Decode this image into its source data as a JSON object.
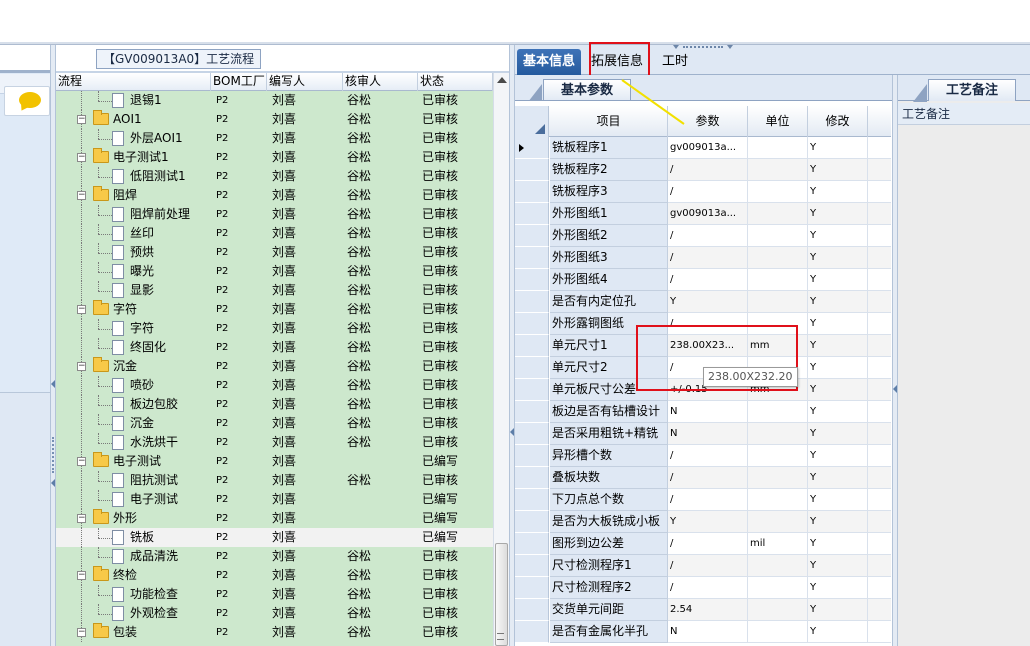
{
  "process_panel": {
    "title": "【GV009013A0】工艺流程",
    "columns": [
      "流程",
      "BOM工厂",
      "编写人",
      "核审人",
      "状态"
    ],
    "rows": [
      {
        "level": 2,
        "kind": "doc",
        "name": "退锡1",
        "bom": "P2",
        "author": "刘喜",
        "reviewer": "谷松",
        "status": "已审核"
      },
      {
        "level": 1,
        "kind": "folder",
        "name": "AOI1",
        "bom": "P2",
        "author": "刘喜",
        "reviewer": "谷松",
        "status": "已审核"
      },
      {
        "level": 2,
        "kind": "doc",
        "name": "外层AOI1",
        "bom": "P2",
        "author": "刘喜",
        "reviewer": "谷松",
        "status": "已审核"
      },
      {
        "level": 1,
        "kind": "folder",
        "name": "电子测试1",
        "bom": "P2",
        "author": "刘喜",
        "reviewer": "谷松",
        "status": "已审核"
      },
      {
        "level": 2,
        "kind": "doc",
        "name": "低阻测试1",
        "bom": "P2",
        "author": "刘喜",
        "reviewer": "谷松",
        "status": "已审核"
      },
      {
        "level": 1,
        "kind": "folder",
        "name": "阻焊",
        "bom": "P2",
        "author": "刘喜",
        "reviewer": "谷松",
        "status": "已审核"
      },
      {
        "level": 2,
        "kind": "doc",
        "name": "阻焊前处理",
        "bom": "P2",
        "author": "刘喜",
        "reviewer": "谷松",
        "status": "已审核"
      },
      {
        "level": 2,
        "kind": "doc",
        "name": "丝印",
        "bom": "P2",
        "author": "刘喜",
        "reviewer": "谷松",
        "status": "已审核"
      },
      {
        "level": 2,
        "kind": "doc",
        "name": "预烘",
        "bom": "P2",
        "author": "刘喜",
        "reviewer": "谷松",
        "status": "已审核"
      },
      {
        "level": 2,
        "kind": "doc",
        "name": "曝光",
        "bom": "P2",
        "author": "刘喜",
        "reviewer": "谷松",
        "status": "已审核"
      },
      {
        "level": 2,
        "kind": "doc",
        "name": "显影",
        "bom": "P2",
        "author": "刘喜",
        "reviewer": "谷松",
        "status": "已审核"
      },
      {
        "level": 1,
        "kind": "folder",
        "name": "字符",
        "bom": "P2",
        "author": "刘喜",
        "reviewer": "谷松",
        "status": "已审核"
      },
      {
        "level": 2,
        "kind": "doc",
        "name": "字符",
        "bom": "P2",
        "author": "刘喜",
        "reviewer": "谷松",
        "status": "已审核"
      },
      {
        "level": 2,
        "kind": "doc",
        "name": "终固化",
        "bom": "P2",
        "author": "刘喜",
        "reviewer": "谷松",
        "status": "已审核"
      },
      {
        "level": 1,
        "kind": "folder",
        "name": "沉金",
        "bom": "P2",
        "author": "刘喜",
        "reviewer": "谷松",
        "status": "已审核"
      },
      {
        "level": 2,
        "kind": "doc",
        "name": "喷砂",
        "bom": "P2",
        "author": "刘喜",
        "reviewer": "谷松",
        "status": "已审核"
      },
      {
        "level": 2,
        "kind": "doc",
        "name": "板边包胶",
        "bom": "P2",
        "author": "刘喜",
        "reviewer": "谷松",
        "status": "已审核"
      },
      {
        "level": 2,
        "kind": "doc",
        "name": "沉金",
        "bom": "P2",
        "author": "刘喜",
        "reviewer": "谷松",
        "status": "已审核"
      },
      {
        "level": 2,
        "kind": "doc",
        "name": "水洗烘干",
        "bom": "P2",
        "author": "刘喜",
        "reviewer": "谷松",
        "status": "已审核"
      },
      {
        "level": 1,
        "kind": "folder",
        "name": "电子测试",
        "bom": "P2",
        "author": "刘喜",
        "reviewer": "",
        "status": "已编写"
      },
      {
        "level": 2,
        "kind": "doc",
        "name": "阻抗测试",
        "bom": "P2",
        "author": "刘喜",
        "reviewer": "谷松",
        "status": "已审核"
      },
      {
        "level": 2,
        "kind": "doc",
        "name": "电子测试",
        "bom": "P2",
        "author": "刘喜",
        "reviewer": "",
        "status": "已编写"
      },
      {
        "level": 1,
        "kind": "folder",
        "name": "外形",
        "bom": "P2",
        "author": "刘喜",
        "reviewer": "",
        "status": "已编写"
      },
      {
        "level": 2,
        "kind": "doc",
        "name": "铣板",
        "bom": "P2",
        "author": "刘喜",
        "reviewer": "",
        "status": "已编写",
        "selected": true
      },
      {
        "level": 2,
        "kind": "doc",
        "name": "成品清洗",
        "bom": "P2",
        "author": "刘喜",
        "reviewer": "谷松",
        "status": "已审核"
      },
      {
        "level": 1,
        "kind": "folder",
        "name": "终检",
        "bom": "P2",
        "author": "刘喜",
        "reviewer": "谷松",
        "status": "已审核"
      },
      {
        "level": 2,
        "kind": "doc",
        "name": "功能检查",
        "bom": "P2",
        "author": "刘喜",
        "reviewer": "谷松",
        "status": "已审核"
      },
      {
        "level": 2,
        "kind": "doc",
        "name": "外观检查",
        "bom": "P2",
        "author": "刘喜",
        "reviewer": "谷松",
        "status": "已审核"
      },
      {
        "level": 1,
        "kind": "folder",
        "name": "包装",
        "bom": "P2",
        "author": "刘喜",
        "reviewer": "谷松",
        "status": "已审核"
      }
    ]
  },
  "tabs": {
    "basic": "基本信息",
    "extended": "拓展信息",
    "hours": "工时"
  },
  "params_panel": {
    "subtab": "基本参数",
    "columns": [
      "项目",
      "参数",
      "单位",
      "修改"
    ],
    "rows": [
      {
        "item": "铣板程序1",
        "value": "gv009013a...",
        "unit": "",
        "modify": "Y"
      },
      {
        "item": "铣板程序2",
        "value": "/",
        "unit": "",
        "modify": "Y"
      },
      {
        "item": "铣板程序3",
        "value": "/",
        "unit": "",
        "modify": "Y"
      },
      {
        "item": "外形图纸1",
        "value": "gv009013a...",
        "unit": "",
        "modify": "Y"
      },
      {
        "item": "外形图纸2",
        "value": "/",
        "unit": "",
        "modify": "Y"
      },
      {
        "item": "外形图纸3",
        "value": "/",
        "unit": "",
        "modify": "Y"
      },
      {
        "item": "外形图纸4",
        "value": "/",
        "unit": "",
        "modify": "Y"
      },
      {
        "item": "是否有内定位孔",
        "value": "Y",
        "unit": "",
        "modify": "Y"
      },
      {
        "item": "外形露铜图纸",
        "value": "/",
        "unit": "",
        "modify": "Y"
      },
      {
        "item": "单元尺寸1",
        "value": "238.00X23...",
        "unit": "mm",
        "modify": "Y"
      },
      {
        "item": "单元尺寸2",
        "value": "/",
        "unit": "",
        "modify": "Y"
      },
      {
        "item": "单元板尺寸公差",
        "value": "+/-0.15",
        "unit": "mm",
        "modify": "Y"
      },
      {
        "item": "板边是否有钻槽设计",
        "value": "N",
        "unit": "",
        "modify": "Y"
      },
      {
        "item": "是否采用粗铣+精铣",
        "value": "N",
        "unit": "",
        "modify": "Y"
      },
      {
        "item": "异形槽个数",
        "value": "/",
        "unit": "",
        "modify": "Y"
      },
      {
        "item": "叠板块数",
        "value": "/",
        "unit": "",
        "modify": "Y"
      },
      {
        "item": "下刀点总个数",
        "value": "/",
        "unit": "",
        "modify": "Y"
      },
      {
        "item": "是否为大板铣成小板",
        "value": "Y",
        "unit": "",
        "modify": "Y"
      },
      {
        "item": "图形到边公差",
        "value": "/",
        "unit": "mil",
        "modify": "Y"
      },
      {
        "item": "尺寸检测程序1",
        "value": "/",
        "unit": "",
        "modify": "Y"
      },
      {
        "item": "尺寸检测程序2",
        "value": "/",
        "unit": "",
        "modify": "Y"
      },
      {
        "item": "交货单元间距",
        "value": "2.54",
        "unit": "",
        "modify": "Y"
      },
      {
        "item": "是否有金属化半孔",
        "value": "N",
        "unit": "",
        "modify": "Y"
      }
    ],
    "tooltip": "238.00X232.20"
  },
  "notes_panel": {
    "subtab": "工艺备注",
    "label": "工艺备注"
  },
  "colors": {
    "tree_bg": "#cde8cd",
    "tab_active": "#2f65ab",
    "highlight": "#e0101a"
  }
}
